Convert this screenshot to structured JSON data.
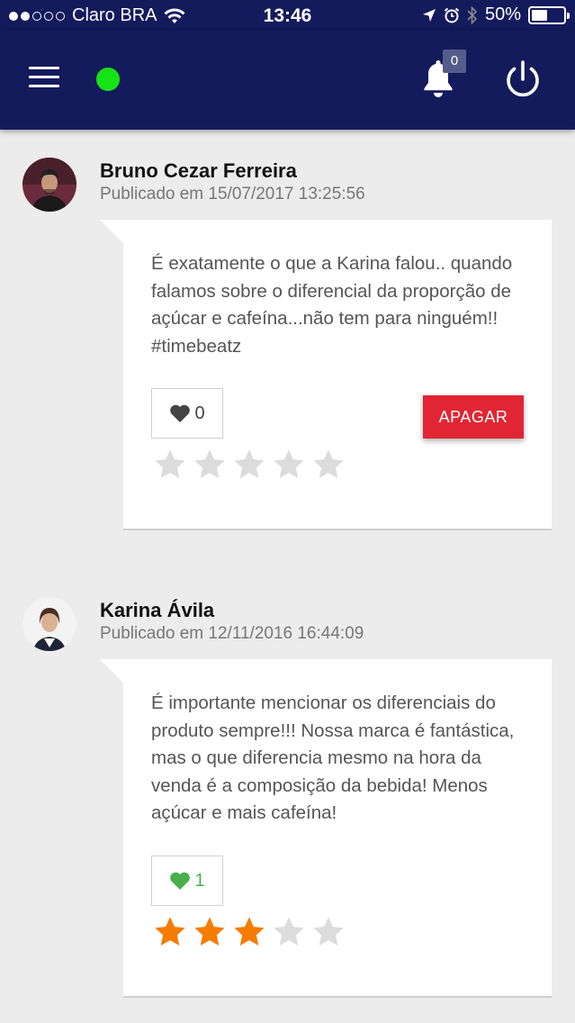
{
  "status_bar": {
    "carrier": "Claro BRA",
    "time": "13:46",
    "battery": "50%",
    "battery_level": 0.5
  },
  "header": {
    "menu_icon": "hamburger-menu-icon",
    "online_status_color": "#16e316",
    "notifications_count": "0",
    "notifications_icon": "bell-icon",
    "power_icon": "power-icon"
  },
  "posts": [
    {
      "author": "Bruno Cezar Ferreira",
      "published": "Publicado em 15/07/2017 13:25:56",
      "text": "É exatamente o que a Karina falou.. quando falamos sobre o diferencial da proporção de açúcar e cafeína...não tem para ninguém!! #timebeatz",
      "likes": "0",
      "liked": false,
      "rating": 0,
      "rating_max": 5,
      "delete_label": "APAGAR"
    },
    {
      "author": "Karina Ávila",
      "published": "Publicado em 12/11/2016 16:44:09",
      "text": "É importante mencionar os diferenciais do produto sempre!!! Nossa marca é fantástica, mas o que diferencia mesmo na hora da venda é a composição da bebida! Menos açúcar e mais cafeína!",
      "likes": "1",
      "liked": true,
      "rating": 3,
      "rating_max": 5
    }
  ],
  "colors": {
    "header_bg": "#141b5c",
    "delete_button": "#e22533",
    "star_active": "#f57c00",
    "star_inactive": "#dcdcdc",
    "like_active": "#48b04c"
  }
}
